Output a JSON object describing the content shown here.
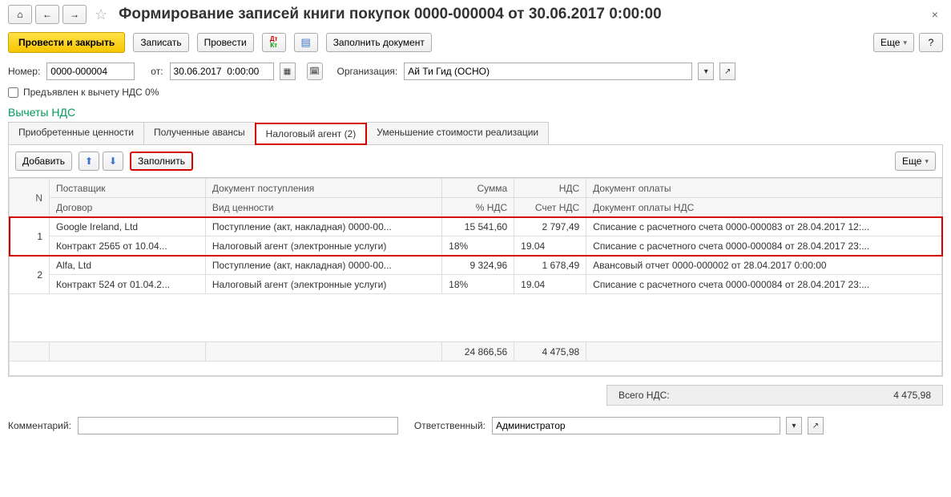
{
  "header": {
    "title": "Формирование записей книги покупок 0000-000004 от 30.06.2017 0:00:00"
  },
  "actions": {
    "primary": "Провести и закрыть",
    "save": "Записать",
    "post": "Провести",
    "fill_doc": "Заполнить документ",
    "more": "Еще",
    "help": "?"
  },
  "form": {
    "number_label": "Номер:",
    "number": "0000-000004",
    "date_label": "от:",
    "date": "30.06.2017  0:00:00",
    "org_label": "Организация:",
    "org": "Ай Ти Гид (ОСНО)",
    "checkbox_label": "Предъявлен к вычету НДС 0%"
  },
  "section_title": "Вычеты НДС",
  "tabs": {
    "t1": "Приобретенные ценности",
    "t2": "Полученные авансы",
    "t3": "Налоговый агент (2)",
    "t4": "Уменьшение стоимости реализации"
  },
  "tab_toolbar": {
    "add": "Добавить",
    "fill": "Заполнить",
    "more": "Еще"
  },
  "table": {
    "headers_top": {
      "n": "N",
      "supplier": "Поставщик",
      "doc": "Документ поступления",
      "sum": "Сумма",
      "nds": "НДС",
      "pay": "Документ оплаты"
    },
    "headers_bot": {
      "contract": "Договор",
      "kind": "Вид ценности",
      "pct": "% НДС",
      "acct": "Счет НДС",
      "pay_nds": "Документ оплаты НДС"
    },
    "rows": [
      {
        "n": "1",
        "supplier": "Google Ireland, Ltd",
        "doc": "Поступление (акт, накладная) 0000-00...",
        "sum": "15 541,60",
        "nds": "2 797,49",
        "pay": "Списание с расчетного счета 0000-000083 от 28.04.2017 12:...",
        "contract": "Контракт 2565 от 10.04...",
        "kind": "Налоговый агент (электронные услуги)",
        "pct": "18%",
        "acct": "19.04",
        "pay_nds": "Списание с расчетного счета 0000-000084 от 28.04.2017 23:..."
      },
      {
        "n": "2",
        "supplier": "Alfa, Ltd",
        "doc": "Поступление (акт, накладная) 0000-00...",
        "sum": "9 324,96",
        "nds": "1 678,49",
        "pay": "Авансовый отчет 0000-000002 от 28.04.2017 0:00:00",
        "contract": "Контракт 524 от 01.04.2...",
        "kind": "Налоговый агент (электронные услуги)",
        "pct": "18%",
        "acct": "19.04",
        "pay_nds": "Списание с расчетного счета 0000-000084 от 28.04.2017 23:..."
      }
    ],
    "footer": {
      "sum": "24 866,56",
      "nds": "4 475,98"
    }
  },
  "totals": {
    "label": "Всего НДС:",
    "value": "4 475,98"
  },
  "bottom": {
    "comment_label": "Комментарий:",
    "comment": "",
    "resp_label": "Ответственный:",
    "resp": "Администратор"
  }
}
